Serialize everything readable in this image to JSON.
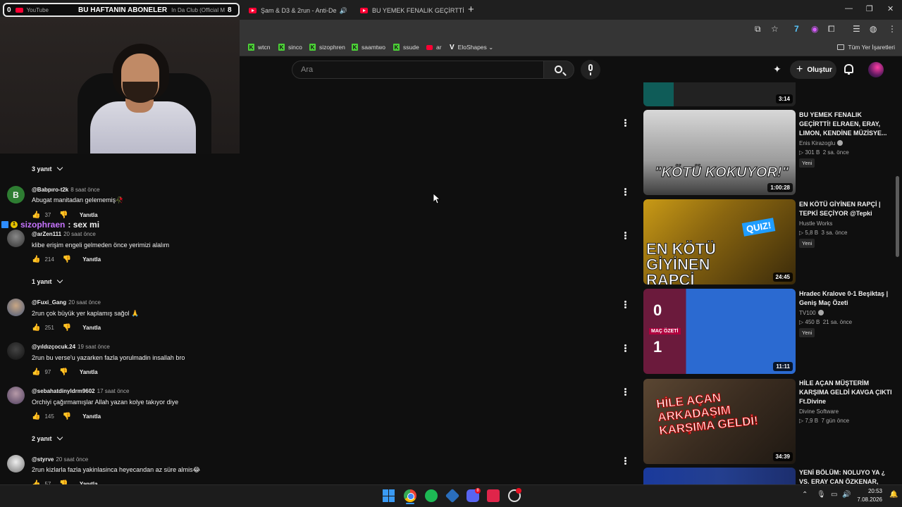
{
  "browser": {
    "tabs": [
      {
        "label": "YouTube",
        "active": false
      },
      {
        "label": "Şam & D3 & 2run - Anti-De",
        "active": true
      },
      {
        "label": "BU YEMEK FENALIK GEÇİRTTİ! E",
        "active": false
      }
    ],
    "new_tab": "+",
    "window_controls": [
      "—",
      "❐",
      "✕"
    ],
    "bookmarks": [
      {
        "label": "wtcn",
        "icon": "kick-icon"
      },
      {
        "label": "sinco",
        "icon": "kick-icon"
      },
      {
        "label": "sizophren",
        "icon": "kick-icon"
      },
      {
        "label": "saamtwo",
        "icon": "kick-icon"
      },
      {
        "label": "ssude",
        "icon": "kick-icon"
      },
      {
        "label": "ar",
        "icon": "youtube-icon"
      },
      {
        "label": "EloShapes ⌄",
        "icon": "v-icon"
      }
    ],
    "bookmarks_right": "Tüm Yer İşaretleri"
  },
  "youtube_header": {
    "search_placeholder": "Ara",
    "create_label": "Oluştur"
  },
  "cam_banner": {
    "left_num": "0",
    "site": "YouTube",
    "title": "BU HAFTANIN ABONELER",
    "subtitle": "In Da Club (Official M",
    "right_num": "8"
  },
  "comments": {
    "reply_toggles": [
      "3 yanıt",
      "1 yanıt",
      "2 yanıt"
    ],
    "reply_label": "Yanıtla",
    "items": [
      {
        "author": "@Babpıro-t2k",
        "time": "8 saat önce",
        "text": "Abugat manitadan gelememiş🥀",
        "likes": "37",
        "avatar_letter": "B",
        "avatar_color": "#2e7d32"
      },
      {
        "author": "@arZen111",
        "time": "20 saat önce",
        "text": "klibe erişim engeli gelmeden önce yerimizi alalım",
        "likes": "214",
        "avatar_letter": "",
        "avatar_color": "#555555"
      },
      {
        "author": "@Fuxi_Gang",
        "time": "20 saat önce",
        "text": "2run çok büyük yer kaplamış sağol 🙏",
        "likes": "251",
        "avatar_letter": "",
        "avatar_color": "#6b7a99"
      },
      {
        "author": "@yıldızçocuk.24",
        "time": "19 saat önce",
        "text": "2run bu verse'u yazarken fazla yorulmadin insallah bro",
        "likes": "97",
        "avatar_letter": "",
        "avatar_color": "#2a2a2a"
      },
      {
        "author": "@sebahatdinyldrm9602",
        "time": "17 saat önce",
        "text": "Orchiyi çağırmamışlar Allah yazan kolye takıyor diye",
        "likes": "145",
        "avatar_letter": "",
        "avatar_color": "#7a6a8a"
      },
      {
        "author": "@styrve",
        "time": "20 saat önce",
        "text": "2run kizlarla fazla yakinlasinca heyecandan az süre almis😂",
        "likes": "57",
        "avatar_letter": "",
        "avatar_color": "#cfcfcf"
      }
    ],
    "chat": {
      "user": "sizophraen",
      "message": ": sex mi",
      "badge": "1"
    }
  },
  "recommendations": [
    {
      "title": "",
      "channel": "",
      "views": "",
      "age": "",
      "duration": "3:14",
      "badge": ""
    },
    {
      "title": "BU YEMEK FENALIK GEÇİRTTİ! ELRAEN, ERAY, LIMON, KENDİNE MÜZİSYE...",
      "channel": "Enis Kirazoglu",
      "verified": true,
      "views": "301 B",
      "age": "2 sa. önce",
      "duration": "1:00:28",
      "badge": "Yeni",
      "thumb_text": "\"KÖTÜ KOKUYOR!\""
    },
    {
      "title": "EN KÖTÜ GİYİNEN RAPÇİ | TEPKİ SEÇİYOR @Tepki",
      "channel": "Hustle Works",
      "verified": false,
      "views": "5,8 B",
      "age": "3 sa. önce",
      "duration": "24:45",
      "badge": "Yeni",
      "thumb_text": "EN KÖTÜ GİYİNEN RAPÇİ",
      "thumb_tag": "QUIZ!"
    },
    {
      "title": "Hradec Kralove 0-1 Beşiktaş | Geniş Maç Özeti",
      "channel": "TV100",
      "verified": true,
      "views": "450 B",
      "age": "21 sa. önce",
      "duration": "11:11",
      "badge": "Yeni",
      "thumb_text": "MAÇ ÖZETİ",
      "score_top": "0",
      "score_bottom": "1"
    },
    {
      "title": "HİLE AÇAN MÜŞTERİM KARŞIMA GELDİ KAVGA ÇIKTI Ft.Divine",
      "channel": "Divine Software",
      "verified": false,
      "views": "7,9 B",
      "age": "7 gün önce",
      "duration": "34:39",
      "badge": "",
      "thumb_text": "HİLE AÇAN ARKADAŞIM KARŞIMA GELDİ!"
    },
    {
      "title": "YENİ BÖLÜM: NOLUYO YA ¿ VS. ERAY CAN ÖZKENAR,",
      "channel": "",
      "views": "",
      "age": "",
      "duration": "",
      "badge": ""
    }
  ],
  "taskbar": {
    "discord_badge": "8",
    "time": "20:53",
    "date": "7.08.2026"
  },
  "colors": {
    "accent": "#ff0033",
    "background": "#0f0f0f",
    "chat_name": "#c774ff"
  }
}
